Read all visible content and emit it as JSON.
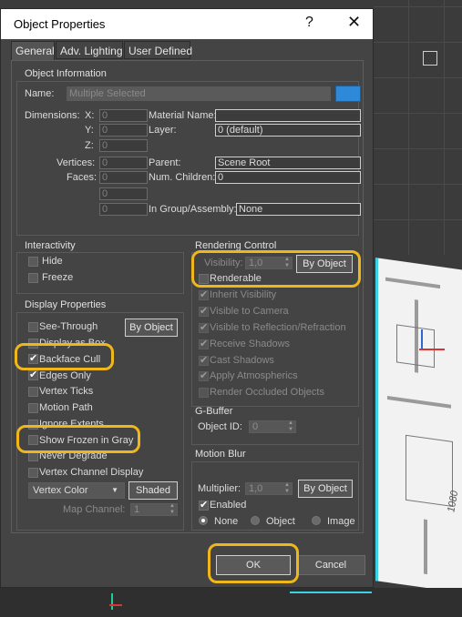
{
  "dialog": {
    "title": "Object Properties",
    "help": "?",
    "close": "✕"
  },
  "tabs": [
    {
      "label": "General",
      "active": true
    },
    {
      "label": "Adv. Lighting"
    },
    {
      "label": "User Defined"
    }
  ],
  "object_info": {
    "group": "Object Information",
    "name_label": "Name:",
    "name_placeholder": "Multiple Selected",
    "dimensions_label": "Dimensions:",
    "x_label": "X:",
    "y_label": "Y:",
    "z_label": "Z:",
    "x": "0",
    "y": "0",
    "z": "0",
    "material_label": "Material Name:",
    "material": "",
    "layer_label": "Layer:",
    "layer": "0 (default)",
    "vertices_label": "Vertices:",
    "vertices": "0",
    "faces_label": "Faces:",
    "faces": "0",
    "extra1": "0",
    "extra2": "0",
    "parent_label": "Parent:",
    "parent": "Scene Root",
    "children_label": "Num. Children:",
    "children": "0",
    "group_label": "In Group/Assembly:",
    "group_value": "None"
  },
  "interactivity": {
    "group": "Interactivity",
    "hide": "Hide",
    "freeze": "Freeze"
  },
  "display": {
    "group": "Display Properties",
    "by_object": "By Object",
    "see_through": "See-Through",
    "display_as_box": "Display as Box",
    "backface_cull": "Backface Cull",
    "edges_only": "Edges Only",
    "vertex_ticks": "Vertex Ticks",
    "motion_path": "Motion Path",
    "ignore_extents": "Ignore Extents",
    "show_frozen_gray": "Show Frozen in Gray",
    "never_degrade": "Never Degrade",
    "vertex_channel_display": "Vertex Channel Display",
    "vertex_color": "Vertex Color",
    "shaded": "Shaded",
    "map_channel_label": "Map Channel:",
    "map_channel": "1"
  },
  "rendering": {
    "group": "Rendering Control",
    "visibility_label": "Visibility:",
    "visibility": "1,0",
    "by_object": "By Object",
    "renderable": "Renderable",
    "inherit_visibility": "Inherit Visibility",
    "visible_to_camera": "Visible to Camera",
    "visible_to_reflection": "Visible to Reflection/Refraction",
    "receive_shadows": "Receive Shadows",
    "cast_shadows": "Cast Shadows",
    "apply_atmospherics": "Apply Atmospherics",
    "render_occluded": "Render Occluded Objects"
  },
  "gbuffer": {
    "group": "G-Buffer",
    "object_id_label": "Object ID:",
    "object_id": "0"
  },
  "motion_blur": {
    "group": "Motion Blur",
    "multiplier_label": "Multiplier:",
    "multiplier": "1,0",
    "by_object": "By Object",
    "enabled": "Enabled",
    "none": "None",
    "object": "Object",
    "image": "Image"
  },
  "footer": {
    "ok": "OK",
    "cancel": "Cancel"
  },
  "viewport": {
    "plan_label": "1080"
  },
  "colors": {
    "highlight": "#f0b71a",
    "swatch": "#2e8ad8",
    "accent_cyan": "#39d3e8"
  }
}
